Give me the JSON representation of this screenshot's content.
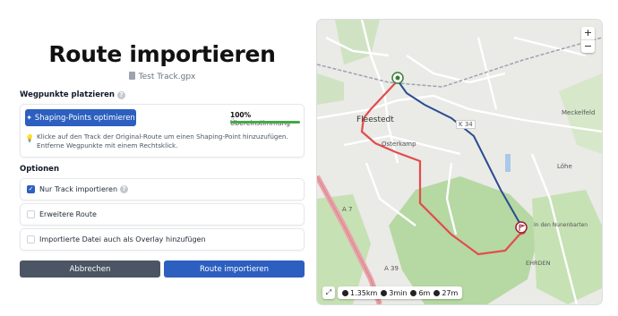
{
  "dialog": {
    "title": "Route importieren",
    "filename": "Test Track.gpx"
  },
  "waypoints": {
    "heading": "Wegpunkte platzieren",
    "shaping_button": "Shaping-Points optimieren",
    "match_value": "100%",
    "match_label": "Übereinstimmung",
    "match_fraction": 1.0,
    "hint": "Klicke auf den Track der Original-Route um einen Shaping-Point hinzuzufügen. Entferne Wegpunkte mit einem Rechtsklick."
  },
  "options": {
    "heading": "Optionen",
    "items": [
      {
        "label": "Nur Track importieren",
        "checked": true,
        "help": true
      },
      {
        "label": "Erweitere Route",
        "checked": false,
        "help": false
      },
      {
        "label": "Importierte Datei auch als Overlay hinzufügen",
        "checked": false,
        "help": false
      }
    ]
  },
  "actions": {
    "cancel": "Abbrechen",
    "import": "Route importieren"
  },
  "map": {
    "zoom_in": "+",
    "zoom_out": "−",
    "stats": {
      "distance": "1.35km",
      "duration": "3min",
      "ascent": "6m",
      "descent": "27m"
    },
    "labels": {
      "town": "Fleestedt",
      "town2": "Meckelfeld",
      "k34": "K 34",
      "a7": "A 7",
      "a39": "A 39",
      "osterkamp": "Osterkamp",
      "ehrden": "EHRDEN",
      "loehe": "Löhe",
      "in_den_nuenenbarten": "In den Nunenbarten"
    },
    "colors": {
      "route_red": "#e24c4c",
      "track_blue": "#2a4d8f",
      "forest": "#b6d8a3",
      "water": "#a9c9e8"
    }
  }
}
